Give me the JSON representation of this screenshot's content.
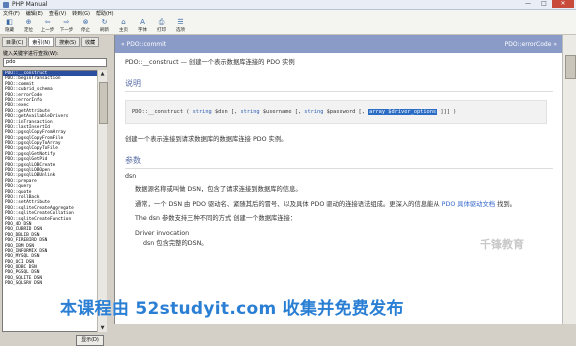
{
  "window": {
    "title": "PHP Manual",
    "min": "—",
    "max": "□",
    "close": "✕"
  },
  "menu": [
    "文件(F)",
    "编辑(E)",
    "查看(V)",
    "转到(G)",
    "帮助(H)"
  ],
  "toolbar": [
    {
      "label": "隐藏",
      "icon": "hide-icon",
      "glyph": "◧"
    },
    {
      "label": "定位",
      "icon": "locate-icon",
      "glyph": "⊕"
    },
    {
      "label": "上一步",
      "icon": "back-icon",
      "glyph": "⇦"
    },
    {
      "label": "下一步",
      "icon": "forward-icon",
      "glyph": "⇨"
    },
    {
      "label": "停止",
      "icon": "stop-icon",
      "glyph": "⊗"
    },
    {
      "label": "刷新",
      "icon": "refresh-icon",
      "glyph": "↻"
    },
    {
      "label": "主页",
      "icon": "home-icon",
      "glyph": "⌂"
    },
    {
      "label": "字体",
      "icon": "font-icon",
      "glyph": "A"
    },
    {
      "label": "打印",
      "icon": "print-icon",
      "glyph": "⎙"
    },
    {
      "label": "选项",
      "icon": "options-icon",
      "glyph": "☰"
    }
  ],
  "sidebar": {
    "tabs": [
      "目录(C)",
      "索引(N)",
      "搜索(S)",
      "收藏"
    ],
    "keyword_label": "键入关键字进行查找(W):",
    "search_value": "pdo",
    "display_button": "显示(D)",
    "items": [
      "PDO::__construct",
      "PDO::beginTransaction",
      "PDO::commit",
      "PDO::cubrid_schema",
      "PDO::errorCode",
      "PDO::errorInfo",
      "PDO::exec",
      "PDO::getAttribute",
      "PDO::getAvailableDrivers",
      "PDO::inTransaction",
      "PDO::lastInsertId",
      "PDO::pgsqlCopyFromArray",
      "PDO::pgsqlCopyFromFile",
      "PDO::pgsqlCopyToArray",
      "PDO::pgsqlCopyToFile",
      "PDO::pgsqlGetNotify",
      "PDO::pgsqlGetPid",
      "PDO::pgsqlLOBCreate",
      "PDO::pgsqlLOBOpen",
      "PDO::pgsqlLOBUnlink",
      "PDO::prepare",
      "PDO::query",
      "PDO::quote",
      "PDO::rollBack",
      "PDO::setAttribute",
      "PDO::sqliteCreateAggregate",
      "PDO::sqliteCreateCollation",
      "PDO::sqliteCreateFunction",
      "PDO_4D DSN",
      "PDO_CUBRID DSN",
      "PDO_DBLIB DSN",
      "PDO_FIREBIRD DSN",
      "PDO_IBM DSN",
      "PDO_INFORMIX DSN",
      "PDO_MYSQL DSN",
      "PDO_OCI DSN",
      "PDO_ODBC DSN",
      "PDO_PGSQL DSN",
      "PDO_SQLITE DSN",
      "PDO_SQLSRV DSN"
    ],
    "selected_index": 0
  },
  "nav": {
    "prev": "« PDO::commit",
    "next": "PDO::errorCode »"
  },
  "content": {
    "heading": "PDO::__construct — 创建一个表示数据库连接的 PDO 实例",
    "desc_title": "说明",
    "code": {
      "name": "PDO::__construct",
      "p1_type": "string",
      "p1": "$dsn",
      "p2_type": "string",
      "p2": "$username",
      "p3_type": "string",
      "p3": "$password",
      "p4_type": "array",
      "p4": "$driver_options",
      "end": "]]] )"
    },
    "desc_text": "创建一个表示连接到请求数据库的数据库连接 PDO 实例。",
    "params_title": "参数",
    "dsn_label": "dsn",
    "dsn_text": "数据源名称或叫做 DSN，包含了请求连接到数据库的信息。",
    "dsn_detail_1": "通常，一个 DSN 由 PDO 驱动名、紧随其后的冒号、以及具体 PDO 驱动的连接语法组成。更深入的信息能从",
    "dsn_link": "PDO 具体驱动文档",
    "dsn_detail_2": "找到。",
    "dsn_support": "The dsn 参数支持三种不同的方式 创建一个数据库连接：",
    "driver_inv": "Driver invocation",
    "driver_inv_text": "dsn 包含完整的DSN。"
  },
  "overlay": {
    "watermark": "本课程由 52studyit.com 收集并免费发布",
    "logo": "千锋教育"
  }
}
